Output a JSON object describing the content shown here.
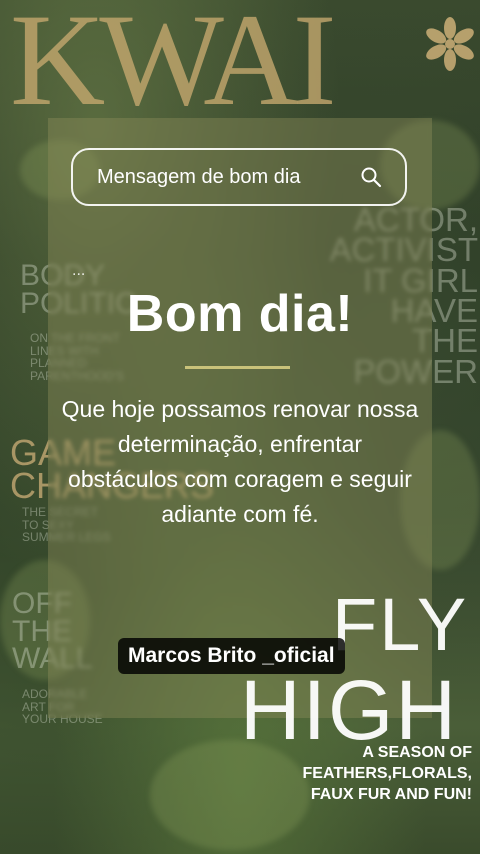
{
  "background": {
    "magazine_title": "KWAI",
    "left_column": {
      "block1": [
        "BODY",
        "POLITIC"
      ],
      "block1_small": [
        "ON THE FRONT",
        "LINES WITH",
        "PLANNED",
        "PARENTHOOD'S"
      ],
      "block2": [
        "GAME",
        "CHANGERS"
      ],
      "block2_small": [
        "THE SECRET",
        "TO SEXY",
        "SUMMER LEGS"
      ],
      "block3": [
        "OFF",
        "THE",
        "WALL"
      ],
      "block3_small": [
        "ADORABLE",
        "ART FOR",
        "YOUR HOUSE"
      ]
    },
    "right_column": [
      "ACTOR,",
      "ACTIVIST",
      "IT GIRL",
      "HAVE THE",
      "POWER"
    ],
    "fly": "FLY",
    "high": "HIGH",
    "season_lines": [
      "A SEASON OF",
      "FEATHERS,FLORALS,",
      "FAUX FUR AND FUN!"
    ]
  },
  "search": {
    "placeholder": "Mensagem de bom dia",
    "icon": "search-icon"
  },
  "ellipsis": "...",
  "title": "Bom dia!",
  "message": "Que hoje possamos renovar nossa determinação, enfrentar obstáculos com coragem e seguir adiante com fé.",
  "username": "Marcos Brito _oficial",
  "colors": {
    "divider": "#c9c27a",
    "gold_text": "#c4a86e",
    "card": "rgba(140,140,90,0.42)"
  }
}
